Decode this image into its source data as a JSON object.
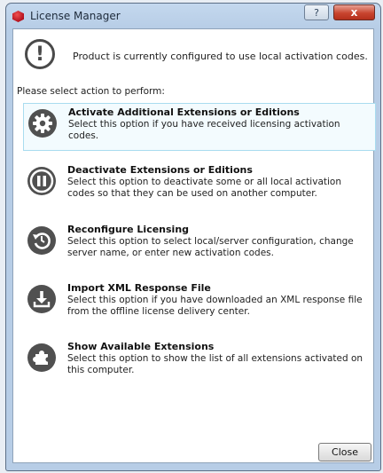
{
  "window": {
    "title": "License Manager",
    "help_label": "?",
    "close_glyph": "x"
  },
  "status": {
    "icon": "exclamation-icon",
    "text": "Product is currently configured to use local activation codes."
  },
  "prompt": "Please select action to perform:",
  "options": [
    {
      "icon": "gear-icon",
      "title": "Activate Additional Extensions or Editions",
      "desc": "Select this option if you have received licensing activation codes.",
      "selected": true
    },
    {
      "icon": "pause-icon",
      "title": "Deactivate Extensions or Editions",
      "desc": "Select this option to deactivate some or all local activation codes so that they can be used on another computer.",
      "selected": false
    },
    {
      "icon": "reconfigure-icon",
      "title": "Reconfigure Licensing",
      "desc": "Select this option to select local/server configuration, change server name, or enter new activation codes.",
      "selected": false
    },
    {
      "icon": "import-icon",
      "title": "Import XML Response File",
      "desc": "Select this option if you have downloaded an XML response file from the offline license delivery center.",
      "selected": false
    },
    {
      "icon": "puzzle-icon",
      "title": "Show Available Extensions",
      "desc": "Select this option to show the list of all extensions activated on this computer.",
      "selected": false
    }
  ],
  "footer": {
    "close_label": "Close"
  },
  "colors": {
    "selected_border": "#a9dcef",
    "icon_fill": "#505050",
    "title_close": "#c8452f"
  }
}
